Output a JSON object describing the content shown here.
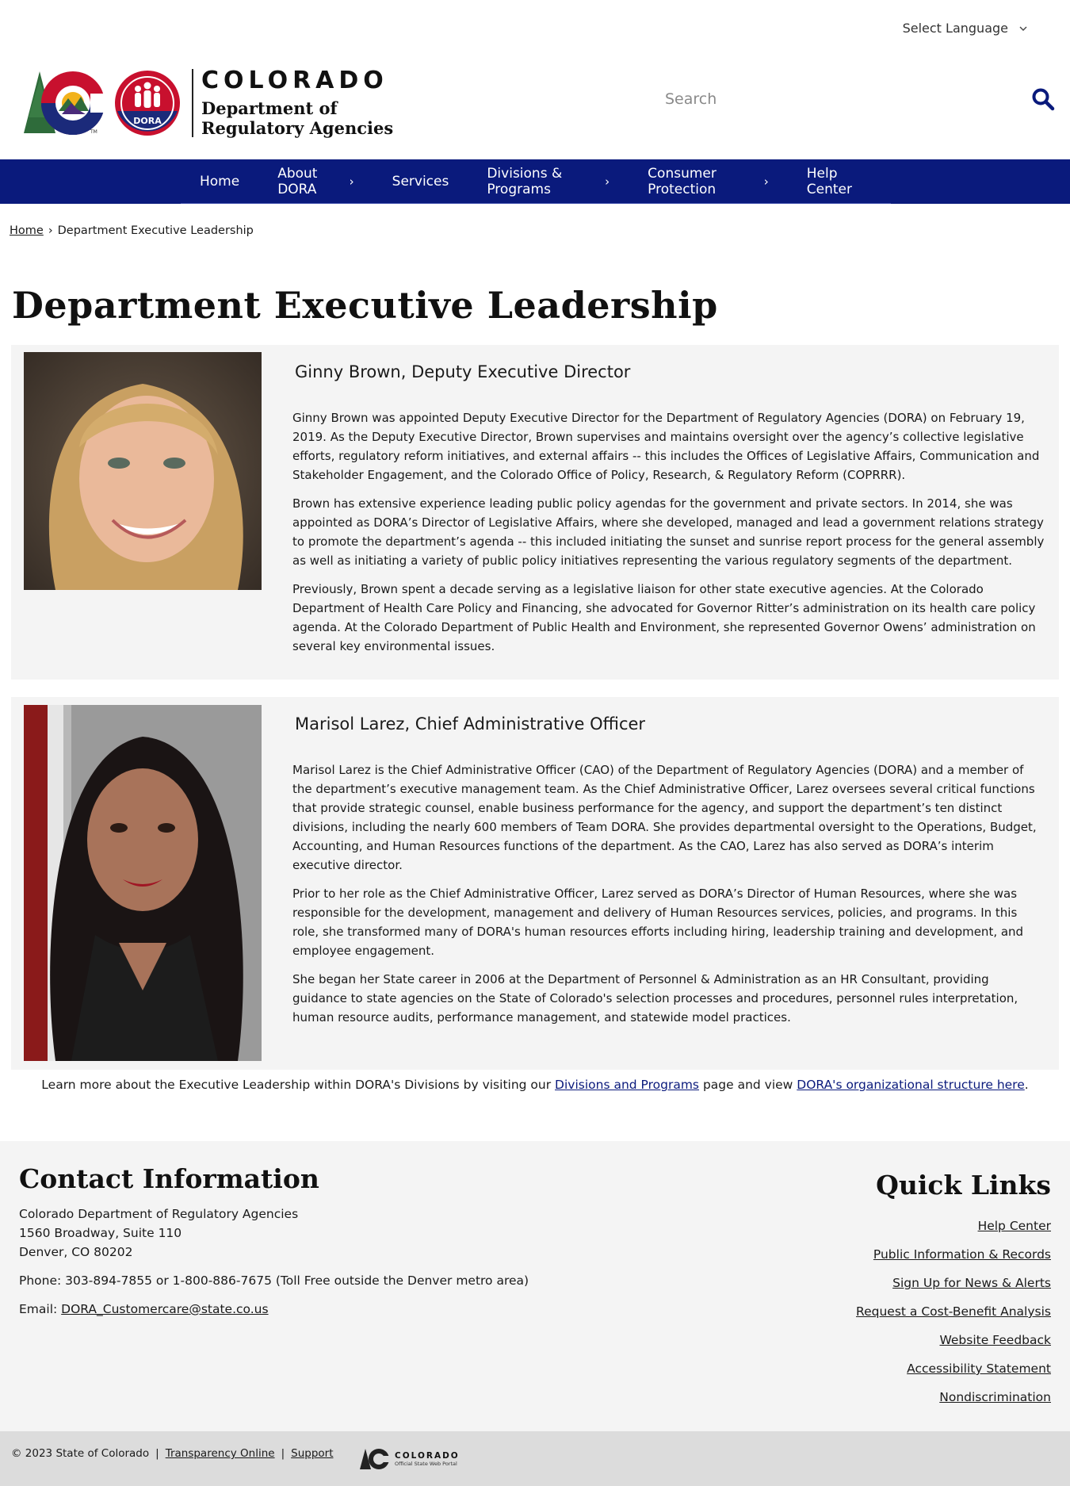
{
  "language": {
    "label": "Select Language"
  },
  "header": {
    "logo_state": "COLORADO",
    "logo_badge": "DORA",
    "logo_dept_line1": "Department of",
    "logo_dept_line2": "Regulatory Agencies",
    "search_placeholder": "Search"
  },
  "nav": {
    "items": [
      {
        "label": "Home",
        "caret": ""
      },
      {
        "label": "About DORA",
        "caret": "›"
      },
      {
        "label": "Services",
        "caret": ""
      },
      {
        "label": "Divisions & Programs",
        "caret": "›"
      },
      {
        "label": "Consumer Protection",
        "caret": "›"
      },
      {
        "label": "Help Center",
        "caret": ""
      }
    ]
  },
  "breadcrumb": {
    "home": "Home",
    "separator": "›",
    "current": "Department Executive Leadership"
  },
  "page_title": "Department Executive Leadership",
  "leaders": [
    {
      "name": "Ginny Brown, Deputy Executive Director",
      "paragraphs": [
        "Ginny Brown was appointed Deputy Executive Director for the Department of Regulatory Agencies (DORA) on February 19, 2019. As the Deputy Executive Director, Brown supervises and maintains oversight over the agency’s collective legislative efforts, regulatory reform initiatives, and external affairs -- this includes the Offices of Legislative Affairs, Communication and Stakeholder Engagement, and the Colorado Office of Policy, Research, & Regulatory Reform (COPRRR).",
        "Brown has extensive experience leading public policy agendas for the government and private sectors. In 2014, she was appointed as DORA’s Director of Legislative Affairs, where she developed, managed and lead a government relations strategy to promote the department’s agenda -- this included initiating the sunset and sunrise report process for the general assembly as well as initiating a variety of public policy initiatives representing the various regulatory segments of the department.",
        "Previously, Brown spent a decade serving as a legislative liaison for other state executive agencies. At the Colorado Department of Health Care Policy and Financing, she advocated for Governor Ritter’s administration on its health care policy agenda. At the Colorado Department of Public Health and Environment, she represented Governor Owens’ administration on several key environmental issues."
      ]
    },
    {
      "name": "Marisol Larez, Chief Administrative Officer",
      "paragraphs": [
        "Marisol Larez is the Chief Administrative Officer (CAO) of the Department of Regulatory Agencies (DORA) and a member of the department’s executive management team. As the Chief Administrative Officer, Larez oversees several critical functions that provide strategic counsel, enable business performance for the agency, and support the department’s ten distinct divisions, including the nearly 600 members of Team DORA. She provides departmental oversight to the Operations, Budget, Accounting, and Human Resources functions of the department. As the CAO, Larez has also served as DORA’s interim executive director.",
        "Prior to her role as the Chief Administrative Officer, Larez served as DORA’s Director of Human Resources, where she was responsible for the development, management and delivery of Human Resources services, policies, and programs. In this role, she transformed many of DORA's human resources efforts including hiring, leadership training and development, and employee engagement.",
        "She began her State career in 2006 at the Department of Personnel & Administration as an HR Consultant, providing guidance to state agencies on the State of Colorado's selection processes and procedures, personnel rules interpretation, human resource audits, performance management, and statewide model practices."
      ]
    }
  ],
  "learn_more": {
    "before": "Learn more about the Executive Leadership within DORA's Divisions by visiting our ",
    "link1": "Divisions and Programs",
    "middle": " page and view ",
    "link2": "DORA's organizational structure here",
    "after": "."
  },
  "contact": {
    "heading": "Contact Information",
    "address_line1": "Colorado Department of Regulatory Agencies",
    "address_line2": "1560 Broadway, Suite 110",
    "address_line3": "Denver, CO 80202",
    "phone": "Phone: 303-894-7855 or 1-800-886-7675 (Toll Free outside the Denver metro area)",
    "email_label": "Email: ",
    "email": "DORA_Customercare@state.co.us"
  },
  "quick_links": {
    "heading": "Quick Links",
    "items": [
      "Help Center",
      "Public Information & Records",
      "Sign Up for News & Alerts",
      "Request a Cost-Benefit Analysis",
      "Website Feedback",
      "Accessibility Statement",
      "Nondiscrimination"
    ]
  },
  "bottom_bar": {
    "copyright": "© 2023 State of Colorado",
    "pipe": "|",
    "link1": "Transparency Online",
    "link2": "Support",
    "portal_title": "COLORADO",
    "portal_subtitle": "Official State Web Portal"
  },
  "colors": {
    "nav_bg": "#0a1a7c",
    "card_bg": "#f4f4f4",
    "footer_bg": "#f4f4f4",
    "bottom_bg": "#dcdcdc",
    "search_icon": "#0a1a7c"
  }
}
